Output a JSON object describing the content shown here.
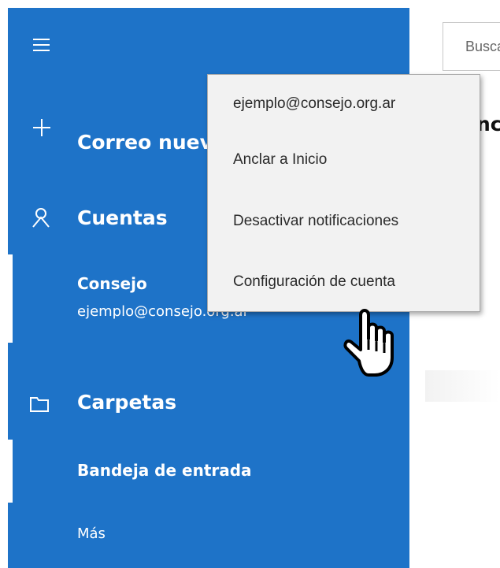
{
  "nav": {
    "new_mail_label": "Correo nuevo",
    "accounts_label": "Cuentas",
    "account": {
      "name": "Consejo",
      "email": "ejemplo@consejo.org.ar"
    },
    "folders_label": "Carpetas",
    "inbox_label": "Bandeja de entrada",
    "more_label": "Más"
  },
  "search": {
    "placeholder": "Buscar"
  },
  "main": {
    "header_partial": "nc"
  },
  "context_menu": {
    "header": "ejemplo@consejo.org.ar",
    "items": [
      "Anclar a Inicio",
      "Desactivar notificaciones",
      "Configuración de cuenta"
    ]
  },
  "colors": {
    "nav_bg": "#1E73C8",
    "menu_bg": "#f2f2f2",
    "nav_text": "#ffffff"
  },
  "icons": [
    "hamburger-icon",
    "plus-icon",
    "person-icon",
    "folder-icon",
    "hand-cursor-icon"
  ]
}
